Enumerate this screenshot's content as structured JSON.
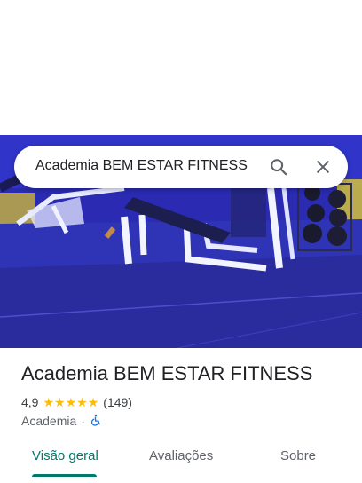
{
  "search": {
    "query": "Academia BEM ESTAR FITNESS",
    "search_icon": "search-icon",
    "close_icon": "close-icon"
  },
  "hero": {
    "description_icon": "gym-photo"
  },
  "place": {
    "title": "Academia BEM ESTAR FITNESS",
    "rating": "4,9",
    "stars_filled": 5,
    "reviews_count": "(149)",
    "category": "Academia",
    "separator": "·",
    "accessibility_icon": "wheelchair-icon"
  },
  "tabs": [
    {
      "label": "Visão geral",
      "active": true
    },
    {
      "label": "Avaliações",
      "active": false
    },
    {
      "label": "Sobre",
      "active": false
    }
  ],
  "colors": {
    "accent": "#00796b",
    "star": "#fbbc04",
    "accessibility": "#1a73e8"
  }
}
